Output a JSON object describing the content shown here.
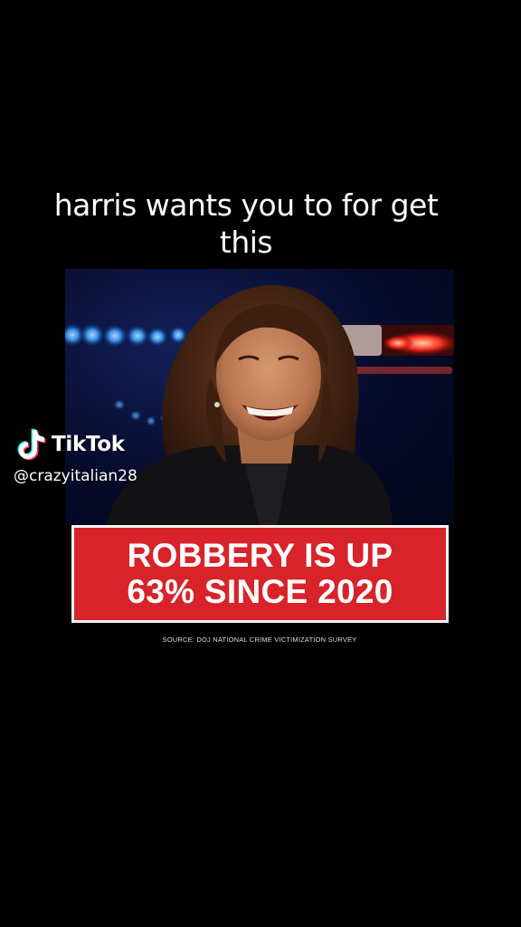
{
  "caption": {
    "line1": "harris wants you to for get",
    "line2": "this"
  },
  "banner": {
    "line1": "ROBBERY IS UP",
    "line2": "63% SINCE 2020"
  },
  "source": "SOURCE: DOJ NATIONAL CRIME VICTIMIZATION SURVEY",
  "watermark": {
    "brand": "TikTok",
    "handle": "@crazyitalian28",
    "logo_icon": "tiktok-logo-icon"
  },
  "colors": {
    "background": "#000000",
    "banner_red": "#d8232a",
    "banner_border": "#f3f3f3",
    "text": "#ffffff",
    "tiktok_cyan": "#25f4ee",
    "tiktok_pink": "#fe2c55"
  }
}
